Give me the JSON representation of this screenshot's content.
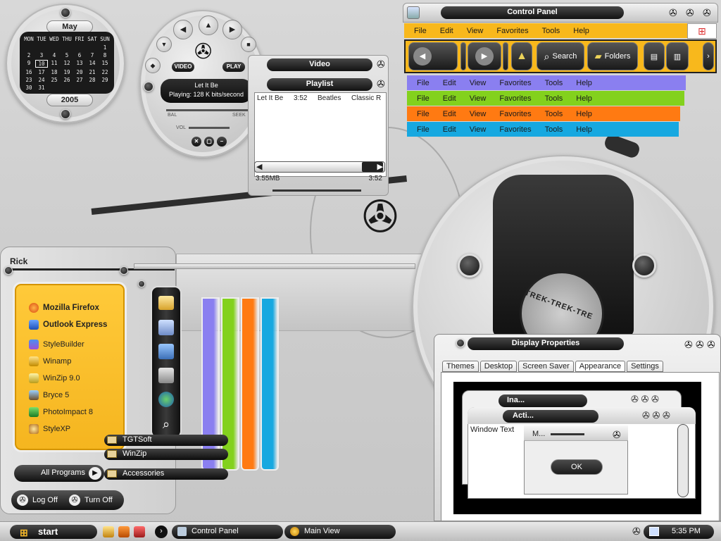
{
  "calendar": {
    "month": "May",
    "year": "2005",
    "weekdays": [
      "MON",
      "TUE",
      "WED",
      "THU",
      "FRI",
      "SAT",
      "SUN"
    ],
    "days": [
      "",
      "",
      "",
      "",
      "",
      "",
      "1",
      "2",
      "3",
      "4",
      "5",
      "6",
      "7",
      "8",
      "9",
      "10",
      "11",
      "12",
      "13",
      "14",
      "15",
      "16",
      "17",
      "18",
      "19",
      "20",
      "21",
      "22",
      "23",
      "24",
      "25",
      "26",
      "27",
      "28",
      "29",
      "30",
      "31",
      "",
      "",
      "",
      "",
      ""
    ],
    "today": "10"
  },
  "player": {
    "video_label": "VIDEO",
    "play_label": "PLAY",
    "track": "Let It Be",
    "status": "Playing: 128 K bits/second",
    "bal_label": "BAL",
    "seek_label": "SEEK",
    "vol_label": "VOL"
  },
  "video_window": {
    "title": "Video",
    "playlist_title": "Playlist",
    "row": {
      "title": "Let It Be",
      "time": "3:52",
      "artist": "Beatles",
      "genre": "Classic R"
    },
    "size": "3.55MB",
    "length": "3:52"
  },
  "control_panel": {
    "title": "Control Panel",
    "menu": [
      "File",
      "Edit",
      "View",
      "Favorites",
      "Tools",
      "Help"
    ],
    "search_label": "Search",
    "folders_label": "Folders",
    "menu_colors": [
      "#f8b81c",
      "#8a7ff0",
      "#83d11d",
      "#ff7a12",
      "#17a8e0"
    ]
  },
  "start_menu": {
    "user": "Rick",
    "pinned": [
      "Mozilla Firefox",
      "Outlook Express"
    ],
    "programs": [
      "StyleBuilder",
      "Winamp",
      "WinZip 9.0",
      "Bryce 5",
      "PhotoImpact 8",
      "StyleXP"
    ],
    "all_programs": "All Programs",
    "log_off": "Log Off",
    "turn_off": "Turn Off",
    "submenu": [
      "TGTSoft",
      "WinZip",
      "Accessories"
    ],
    "bar_colors": [
      "#8a7ff0",
      "#83d11d",
      "#ff7a12",
      "#17a8e0"
    ]
  },
  "background": {
    "brand": "TREK-TREK-TRE"
  },
  "display_properties": {
    "title": "Display Properties",
    "tabs": [
      "Themes",
      "Desktop",
      "Screen Saver",
      "Appearance",
      "Settings"
    ],
    "active_tab": "Appearance",
    "inactive_title": "Ina...",
    "active_title": "Acti...",
    "window_text": "Window Text",
    "msg_title": "M...",
    "ok_label": "OK"
  },
  "taskbar": {
    "start_label": "start",
    "tasks": [
      "Control Panel",
      "Main View"
    ],
    "clock": "5:35 PM"
  }
}
